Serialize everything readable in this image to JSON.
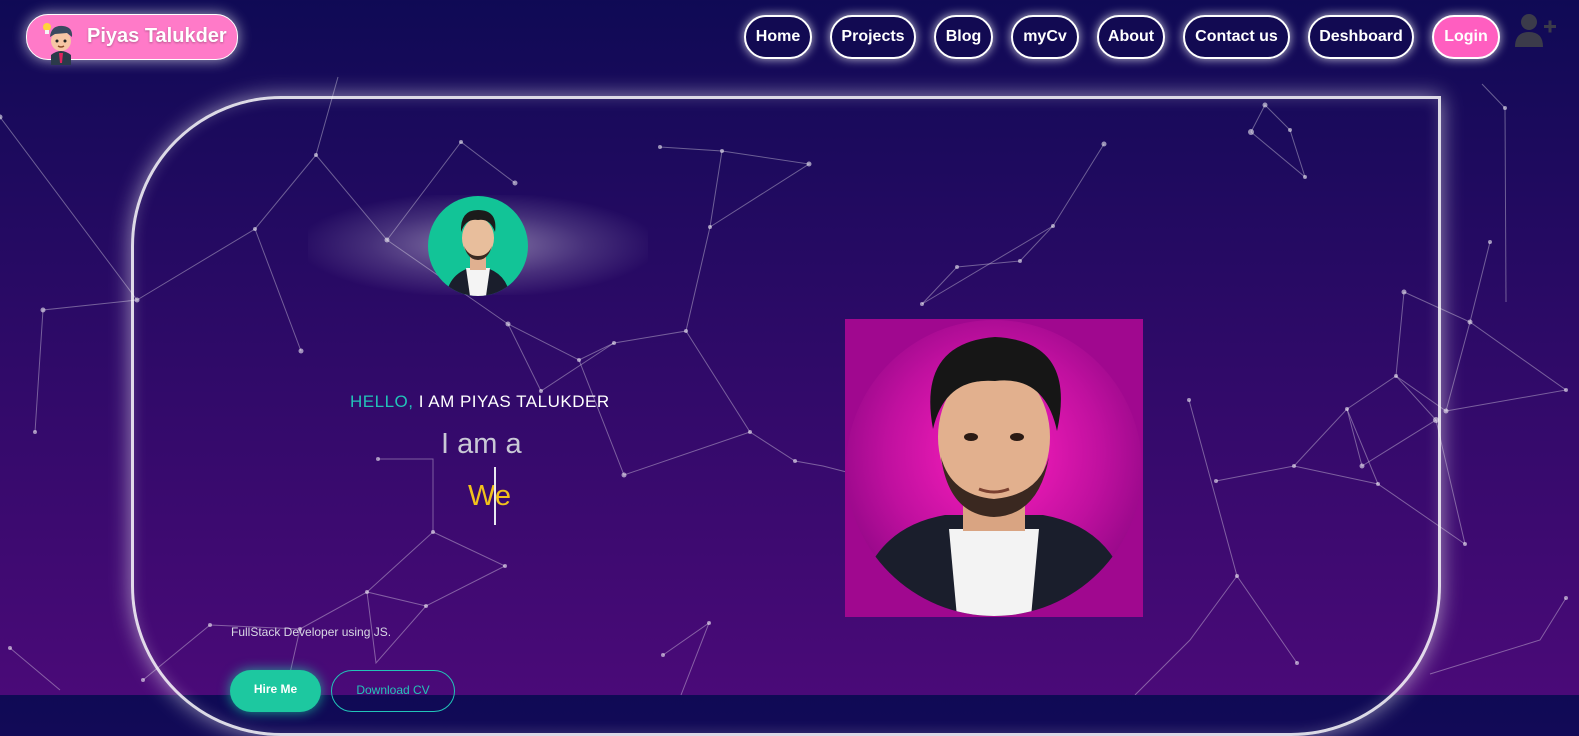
{
  "header": {
    "brand_name": "Piyas Talukder",
    "nav": [
      "Home",
      "Projects",
      "Blog",
      "myCv",
      "About",
      "Contact us",
      "Deshboard",
      "Login"
    ]
  },
  "hero": {
    "hello": "HELLO,",
    "name_line": "I AM PIYAS TALUKDER",
    "iam": "I am a",
    "typed": "We",
    "subtitle": "FullStack Developer using JS.",
    "hire_label": "Hire Me",
    "download_label": "Download CV"
  },
  "colors": {
    "accent_teal": "#22c4b8",
    "brand_pink": "#ff7ac8",
    "typed_yellow": "#f2c21b",
    "photo_bg": "#a0088f"
  }
}
